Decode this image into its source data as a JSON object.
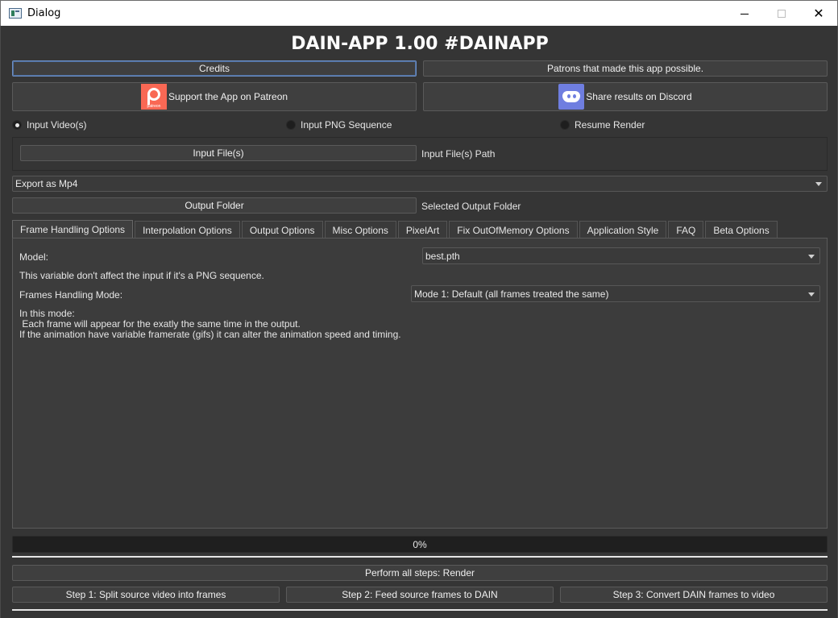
{
  "window": {
    "title": "Dialog",
    "minimize_label": "",
    "close_glyph": "✕"
  },
  "header": {
    "title": "DAIN-APP 1.00 #DAINAPP"
  },
  "buttons": {
    "credits": "Credits",
    "patrons": "Patrons that made this app possible.",
    "patreon": "Support the App on Patreon",
    "discord": "Share results on Discord",
    "input_files": "Input File(s)",
    "output_folder": "Output Folder",
    "render_all": "Perform all steps: Render",
    "step1": "Step 1: Split source video into frames",
    "step2": "Step 2: Feed source frames to DAIN",
    "step3": "Step 3: Convert DAIN frames to video"
  },
  "logos": {
    "patreon_word": "patreon"
  },
  "input_mode": {
    "options": [
      "Input Video(s)",
      "Input PNG Sequence",
      "Resume Render"
    ],
    "selected": "Input Video(s)"
  },
  "paths": {
    "input_path": "Input File(s) Path",
    "output_path": "Selected Output Folder"
  },
  "export_format": {
    "selected": "Export as Mp4"
  },
  "tabs": [
    "Frame Handling Options",
    "Interpolation Options",
    "Output Options",
    "Misc Options",
    "PixelArt",
    "Fix OutOfMemory Options",
    "Application Style",
    "FAQ",
    "Beta Options"
  ],
  "active_tab": "Frame Handling Options",
  "frame_handling": {
    "model_label": "Model:",
    "model_value": "best.pth",
    "png_note": "This variable don't affect the input if it's a PNG sequence.",
    "mode_label": "Frames Handling Mode:",
    "mode_value": "Mode 1: Default (all frames treated the same)",
    "description": [
      "In this mode:",
      " Each frame will appear for the exatly the same time in the output.",
      "If the animation have variable framerate (gifs) it can alter the animation speed and timing."
    ]
  },
  "progress": {
    "value": 0,
    "label": "0%"
  },
  "colors": {
    "background": "#353535",
    "patreon": "#f96854",
    "discord": "#6f7ee0",
    "focus": "#6d8fc3"
  },
  "icons": {
    "app": "dialog-app-icon",
    "patreon": "patreon-logo-icon",
    "discord": "discord-logo-icon"
  }
}
